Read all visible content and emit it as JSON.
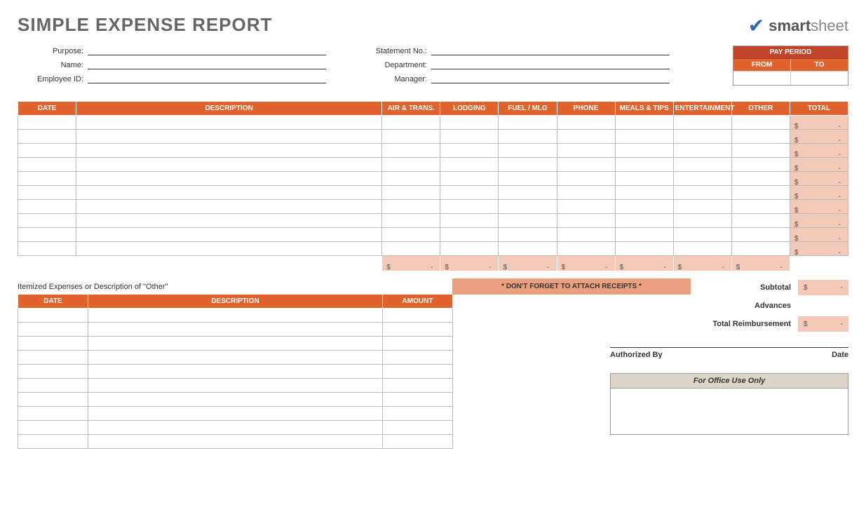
{
  "title": "SIMPLE EXPENSE REPORT",
  "logo": {
    "brand1": "smart",
    "brand2": "sheet"
  },
  "meta_left": {
    "purpose": "Purpose:",
    "name": "Name:",
    "employee_id": "Employee ID:"
  },
  "meta_right": {
    "statement_no": "Statement No.:",
    "department": "Department:",
    "manager": "Manager:"
  },
  "pay_period": {
    "title": "PAY PERIOD",
    "from": "FROM",
    "to": "TO"
  },
  "columns": [
    "DATE",
    "DESCRIPTION",
    "AIR & TRANS.",
    "LODGING",
    "FUEL / MLG",
    "PHONE",
    "MEALS & TIPS",
    "ENTERTAINMENT",
    "OTHER",
    "TOTAL"
  ],
  "total_cell": {
    "dollar": "$",
    "dash": "-"
  },
  "row_count": 10,
  "receipts_note": "* DON'T FORGET TO ATTACH RECEIPTS *",
  "summary": {
    "subtotal": "Subtotal",
    "advances": "Advances",
    "total_reimb": "Total Reimbursement"
  },
  "itemized": {
    "caption": "Itemized Expenses or Description of \"Other\"",
    "cols": [
      "DATE",
      "DESCRIPTION",
      "AMOUNT"
    ],
    "row_count": 10
  },
  "signature": {
    "authorized": "Authorized By",
    "date": "Date"
  },
  "office": {
    "head": "For Office Use Only"
  }
}
